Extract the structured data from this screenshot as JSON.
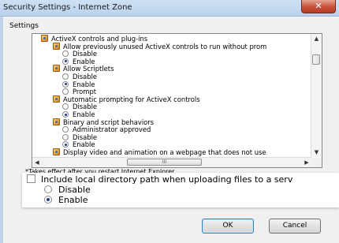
{
  "window": {
    "title": "Security Settings - Internet Zone",
    "close_glyph": "✕"
  },
  "settings": {
    "group_label": "Settings",
    "tree": [
      {
        "kind": "group",
        "text": "ActiveX controls and plug-ins",
        "indent": 0
      },
      {
        "kind": "group",
        "text": "Allow previously unused ActiveX controls to run without prom",
        "indent": 1
      },
      {
        "kind": "radio",
        "text": "Disable",
        "checked": false
      },
      {
        "kind": "radio",
        "text": "Enable",
        "checked": true
      },
      {
        "kind": "group",
        "text": "Allow Scriptlets",
        "indent": 1
      },
      {
        "kind": "radio",
        "text": "Disable",
        "checked": false
      },
      {
        "kind": "radio",
        "text": "Enable",
        "checked": true
      },
      {
        "kind": "radio",
        "text": "Prompt",
        "checked": false
      },
      {
        "kind": "group",
        "text": "Automatic prompting for ActiveX controls",
        "indent": 1
      },
      {
        "kind": "radio",
        "text": "Disable",
        "checked": false
      },
      {
        "kind": "radio",
        "text": "Enable",
        "checked": true
      },
      {
        "kind": "group",
        "text": "Binary and script behaviors",
        "indent": 1
      },
      {
        "kind": "radio",
        "text": "Administrator approved",
        "checked": false
      },
      {
        "kind": "radio",
        "text": "Disable",
        "checked": false
      },
      {
        "kind": "radio",
        "text": "Enable",
        "checked": true
      },
      {
        "kind": "group",
        "text": "Display video and animation on a webpage that does not use",
        "indent": 1
      }
    ],
    "hscroll_thumb_glyph": "III",
    "footnote": "*Takes effect after you restart Internet Explorer"
  },
  "zoomed": {
    "checkbox_label": "Include local directory path when uploading files to a serv",
    "options": [
      {
        "text": "Disable",
        "checked": false
      },
      {
        "text": "Enable",
        "checked": true
      }
    ]
  },
  "buttons": {
    "ok": "OK",
    "cancel": "Cancel"
  }
}
